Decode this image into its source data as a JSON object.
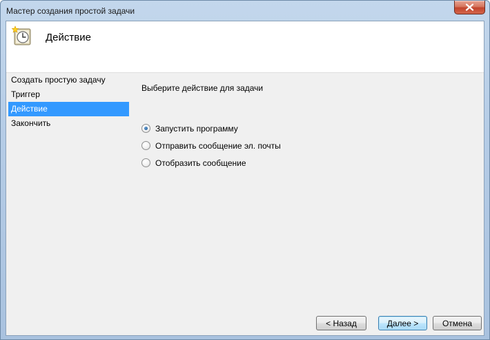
{
  "window": {
    "title": "Мастер создания простой задачи"
  },
  "header": {
    "title": "Действие",
    "icon": "scheduled-task-clock-icon"
  },
  "nav": {
    "items": [
      {
        "label": "Создать простую задачу",
        "active": false
      },
      {
        "label": "Триггер",
        "active": false
      },
      {
        "label": "Действие",
        "active": true
      },
      {
        "label": "Закончить",
        "active": false
      }
    ]
  },
  "content": {
    "prompt": "Выберите действие для задачи",
    "options": [
      {
        "label": "Запустить программу",
        "checked": true
      },
      {
        "label": "Отправить сообщение эл. почты",
        "checked": false
      },
      {
        "label": "Отобразить сообщение",
        "checked": false
      }
    ]
  },
  "buttons": {
    "back": "< Назад",
    "next": "Далее >",
    "cancel": "Отмена"
  },
  "colors": {
    "selection": "#3399ff",
    "close_button": "#c2442c"
  }
}
